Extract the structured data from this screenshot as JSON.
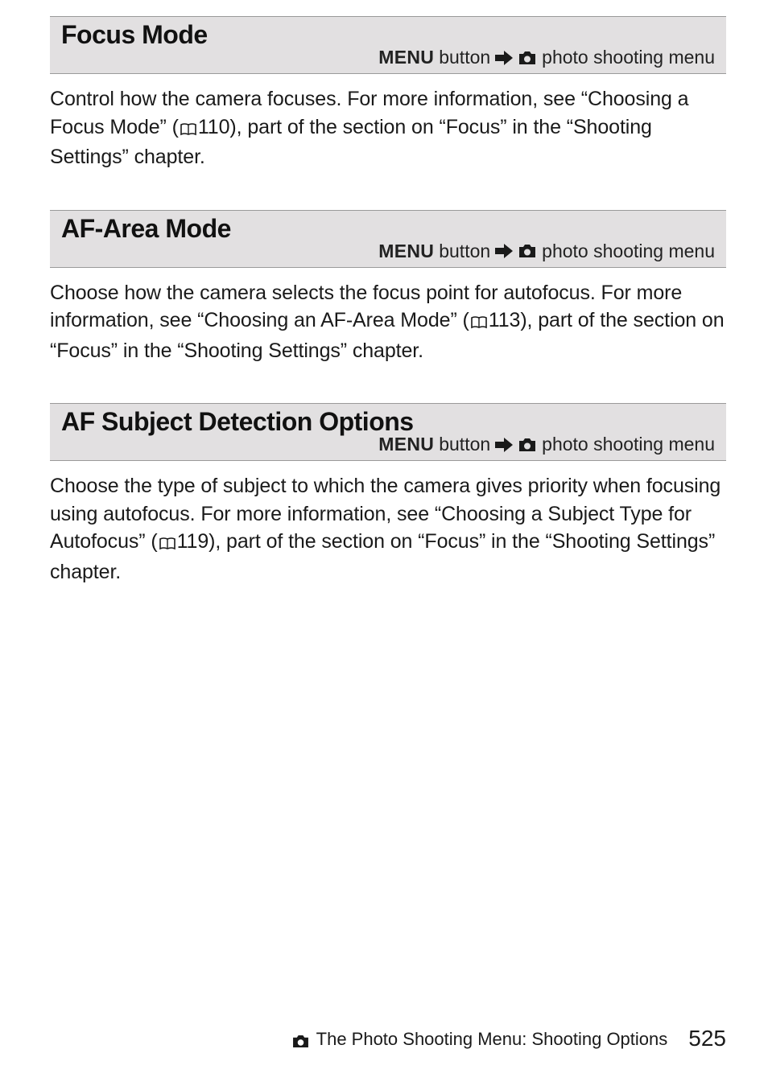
{
  "sections": [
    {
      "title": "Focus Mode",
      "breadcrumb": {
        "menu": "MENU",
        "button": " button",
        "suffix": "   photo shooting menu"
      },
      "body_pre": "Control how the camera focuses. For more information, see “Choosing a Focus Mode” (",
      "body_ref": "110",
      "body_post": "), part of the section on “Focus” in the “Shooting Settings” chapter."
    },
    {
      "title": "AF-Area Mode",
      "breadcrumb": {
        "menu": "MENU",
        "button": " button",
        "suffix": "   photo shooting menu"
      },
      "body_pre": "Choose how the camera selects the focus point for autofocus. For more information, see “Choosing an AF-Area Mode” (",
      "body_ref": "113",
      "body_post": "), part of the section on “Focus” in the “Shooting Settings” chapter."
    },
    {
      "title": "AF Subject Detection Options",
      "breadcrumb": {
        "menu": "MENU",
        "button": " button",
        "suffix": "   photo shooting menu"
      },
      "body_pre": "Choose the type of subject to which the camera gives priority when focusing using autofocus. For more information, see “Choosing a Subject Type for Autofocus” (",
      "body_ref": "119",
      "body_post": "), part of the section on “Focus” in the “Shooting Settings” chapter."
    }
  ],
  "footer": {
    "label": "The Photo Shooting Menu: Shooting Options",
    "page": "525"
  }
}
